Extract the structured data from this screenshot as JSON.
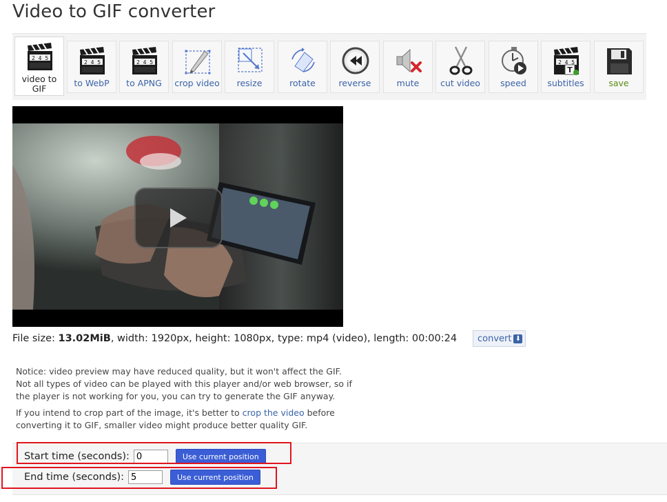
{
  "page": {
    "title": "Video to GIF converter"
  },
  "toolbar": {
    "items": [
      {
        "label": "video to\nGIF",
        "icon": "clapperboard-icon",
        "active": true
      },
      {
        "label": "to WebP",
        "icon": "clapperboard-icon"
      },
      {
        "label": "to APNG",
        "icon": "clapperboard-icon"
      },
      {
        "label": "crop video",
        "icon": "crop-icon"
      },
      {
        "label": "resize",
        "icon": "resize-icon"
      },
      {
        "label": "rotate",
        "icon": "rotate-icon"
      },
      {
        "label": "reverse",
        "icon": "rewind-icon"
      },
      {
        "label": "mute",
        "icon": "mute-icon"
      },
      {
        "label": "cut video",
        "icon": "scissors-icon"
      },
      {
        "label": "speed",
        "icon": "stopwatch-icon"
      },
      {
        "label": "subtitles",
        "icon": "subtitles-icon"
      },
      {
        "label": "save",
        "icon": "floppy-disk-icon"
      }
    ],
    "clapper_digits": "2 4 5"
  },
  "fileinfo": {
    "prefix": "File size: ",
    "size": "13.02MiB",
    "rest": ", width: 1920px, height: 1080px, type: mp4 (video), length: 00:00:24",
    "convert_label": "convert"
  },
  "notice": {
    "line1": "Notice: video preview may have reduced quality, but it won't affect the GIF.",
    "line2": "Not all types of video can be played with this player and/or web browser, so if the player is not working for you, you can try to generate the GIF anyway.",
    "p2_before": "If you intend to crop part of the image, it's better to ",
    "p2_link": "crop the video",
    "p2_after": " before converting it to GIF, smaller video might produce better quality GIF."
  },
  "time": {
    "start_label": "Start time (seconds):",
    "start_value": "0",
    "end_label": "End time (seconds):",
    "end_value": "5",
    "button_label": "Use current position"
  },
  "colors": {
    "accent": "#3b5ed6",
    "link": "#3a63a8",
    "highlight": "#e0141c",
    "save": "#5a8a16"
  }
}
